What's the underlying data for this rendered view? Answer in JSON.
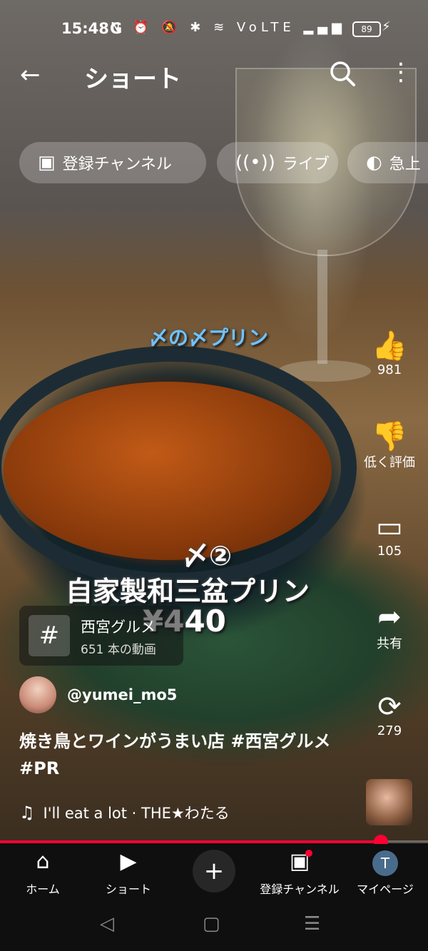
{
  "status_bar": {
    "time": "15:48",
    "carrier_icon": "G",
    "icons": "N ⏰ 🔕 ✱ ≋ VoLTE ▂▄▆",
    "battery": "89"
  },
  "header": {
    "title": "ショート",
    "back_icon": "arrow-left",
    "search_icon": "search",
    "more_icon": "more-vertical"
  },
  "chips": [
    {
      "label": "登録チャンネル",
      "icon": "subscriptions"
    },
    {
      "label": "ライブ",
      "icon": "live"
    },
    {
      "label": "急上",
      "icon": "trending"
    }
  ],
  "video_overlay": {
    "line1": "〆の〆プリン",
    "line2": "〆②",
    "line3": "自家製和三盆プリン",
    "line4": "¥440"
  },
  "actions": {
    "likes": "981",
    "dislike_label": "低く評価",
    "comments": "105",
    "share_label": "共有",
    "remix": "279"
  },
  "hashtag_chip": {
    "symbol": "#",
    "name": "西宮グルメ",
    "count": "651 本の動画"
  },
  "channel": {
    "handle": "@yumei_mo5"
  },
  "caption": "焼き鳥とワインがうまい店 #西宮グルメ #PR",
  "music": {
    "track": "I'll eat a lot · THE★わたる"
  },
  "progress": {
    "fraction": 0.89
  },
  "nav": {
    "home": "ホーム",
    "shorts": "ショート",
    "subscriptions": "登録チャンネル",
    "mypage": "マイページ",
    "avatar_letter": "T"
  },
  "colors": {
    "accent": "#ff0033",
    "background": "#0f0f0f"
  }
}
